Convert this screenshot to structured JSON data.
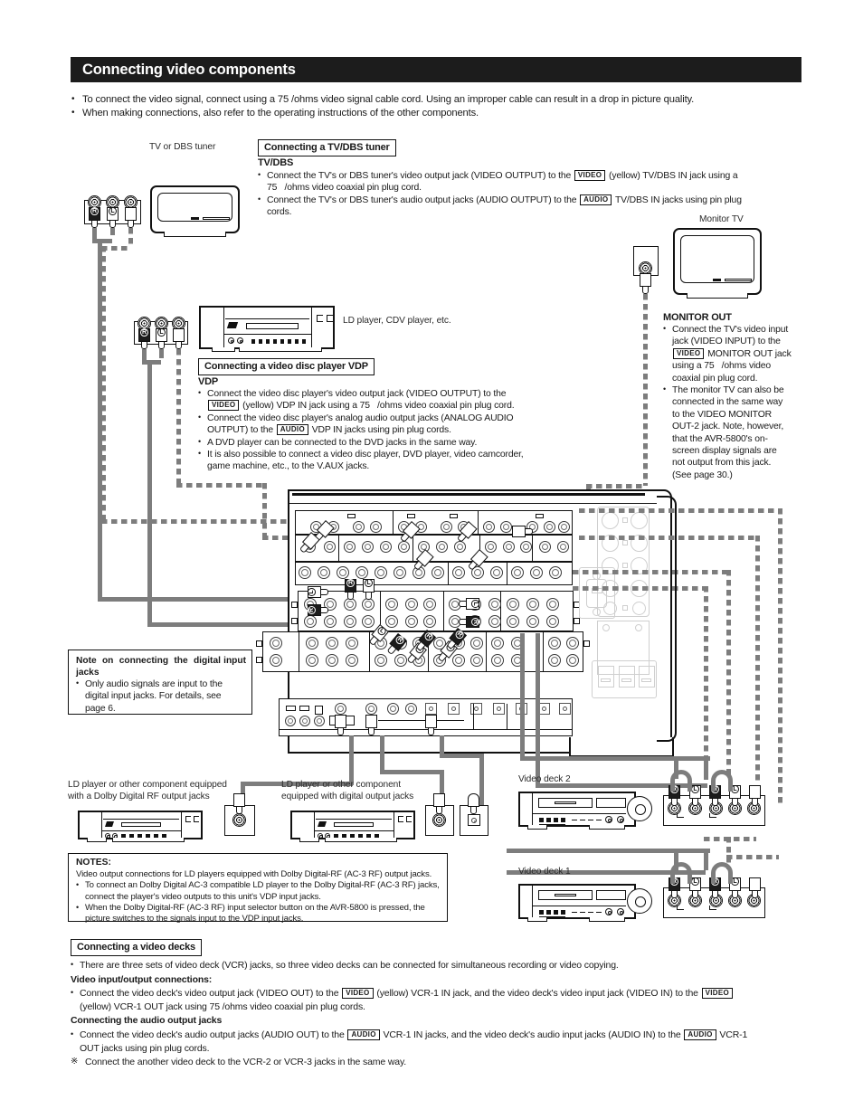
{
  "header": {
    "title": "Connecting video components",
    "bullets": [
      "To connect the video signal, connect using a 75   /ohms video signal cable cord. Using an improper cable can result in a drop in picture quality.",
      "When making connections, also refer to the  operating instructions of the other components."
    ]
  },
  "tvdbs": {
    "caption": "Connecting a TV/DBS tuner",
    "heading": "TV/DBS",
    "device_label": "TV or DBS tuner",
    "lines": [
      {
        "pre": "Connect the TV's or DBS tuner's video output jack (VIDEO OUTPUT) to the ",
        "tag": "VIDEO",
        "post": " (yellow) TV/DBS IN jack using a"
      },
      {
        "cont": "75   /ohms video coaxial pin plug cord."
      },
      {
        "pre": "Connect the TV's or DBS tuner's audio output jacks (AUDIO OUTPUT) to the ",
        "tag": "AUDIO",
        "post": " TV/DBS IN jacks using pin plug"
      },
      {
        "cont": "cords."
      }
    ]
  },
  "vdp": {
    "caption": "Connecting a video disc player VDP",
    "heading": "VDP",
    "device_label": "LD player, CDV player, etc.",
    "lines": [
      {
        "pre": "Connect the video disc player's video output jack (VIDEO OUTPUT) to the",
        "tag": "",
        "post": ""
      },
      {
        "tag": "VIDEO",
        "post": " (yellow) VDP IN jack using a 75   /ohms video coaxial pin plug cord.",
        "indent": true
      },
      {
        "pre": "Connect the video disc player's analog audio output jacks (ANALOG AUDIO"
      },
      {
        "cont_pre": "OUTPUT) to the ",
        "tag": "AUDIO",
        "post": " VDP IN jacks using pin plug cords.",
        "indent": true
      },
      {
        "pre": "A DVD player can be connected to the DVD jacks in the same way."
      },
      {
        "pre": "It is also possible to connect a video disc player, DVD player, video camcorder,"
      },
      {
        "cont": "game machine, etc., to the V.AUX jacks."
      }
    ]
  },
  "monitor": {
    "device_label": "Monitor TV",
    "heading": "MONITOR OUT",
    "lines": [
      {
        "pre": "Connect the TV's video input"
      },
      {
        "cont": "jack (VIDEO INPUT) to the"
      },
      {
        "tag": "VIDEO",
        "post": " MONITOR OUT jack",
        "indent": true
      },
      {
        "cont": "using a 75   /ohms video"
      },
      {
        "cont": "coaxial pin plug cord."
      },
      {
        "pre": "The monitor TV can also be"
      },
      {
        "cont": "connected in the same way"
      },
      {
        "cont": "to the VIDEO MONITOR"
      },
      {
        "cont": "OUT-2 jack. Note, however,"
      },
      {
        "cont": "that the AVR-5800's on-"
      },
      {
        "cont": "screen display signals are"
      },
      {
        "cont": "not output from this jack."
      },
      {
        "cont": "(See page 30.)"
      }
    ]
  },
  "digital_note": {
    "title": "Note on connecting the digital input jacks",
    "lines": [
      "Only audio signals are input to the",
      "digital input jacks. For details, see",
      "page 6."
    ]
  },
  "ld_labels": {
    "rf": "LD player or other component equipped with a Dolby Digital RF output jacks",
    "rf_l1": "LD player or other component equipped",
    "rf_l2": "with a Dolby Digital RF output jacks",
    "dig_l1": "LD  player  or  other  component",
    "dig_l2": "equipped with digital output jacks"
  },
  "decks": {
    "deck2_label": "Video deck 2",
    "deck1_label": "Video deck 1"
  },
  "notes_box": {
    "title": "NOTES:",
    "intro": "Video output connections for LD players equipped with Dolby Digital-RF (AC-3 RF) output jacks.",
    "items": [
      [
        "To connect an Dolby Digital AC-3 compatible LD player to the Dolby Digital-RF (AC-3 RF) jacks,",
        "connect the player's video outputs to this unit's VDP input jacks."
      ],
      [
        "When the Dolby Digital-RF (AC-3 RF) input selector button on the AVR-5800 is pressed, the",
        "picture switches to the signals input to the VDP input jacks."
      ]
    ]
  },
  "video_decks_section": {
    "caption": "Connecting a video decks",
    "intro": "There are three sets of video deck (VCR) jacks, so three video decks can be connected for simultaneous recording or video copying.",
    "h1": "Video input/output connections:",
    "l1_pre": "Connect the video deck's video output jack (VIDEO OUT) to the ",
    "l1_tag1": "VIDEO",
    "l1_mid": " (yellow) VCR-1 IN jack, and the video deck's video input jack (VIDEO IN) to the ",
    "l1_tag2": "VIDEO",
    "l1_cont": "(yellow) VCR-1 OUT jack using 75   /ohms video coaxial pin plug cords.",
    "h2": "Connecting the audio output jacks",
    "l2_pre": "Connect the video deck's audio output jacks (AUDIO OUT) to the ",
    "l2_tag1": "AUDIO",
    "l2_mid": " VCR-1 IN jacks, and the video deck's audio input jacks (AUDIO IN) to the ",
    "l2_tag2": "AUDIO",
    "l2_end": " VCR-1",
    "l2_cont": "OUT jacks using pin plug cords.",
    "l3_mark": "※",
    "l3": "Connect the another video deck to the VCR-2 or VCR-3 jacks in the same way."
  },
  "plug_channels": {
    "r": "R",
    "l": "L"
  },
  "colors": {
    "header_bg": "#1c1c1c",
    "text": "#1a1a1a",
    "cable_gray": "#7d7d7d",
    "faint_gray": "#cfcfcf"
  }
}
